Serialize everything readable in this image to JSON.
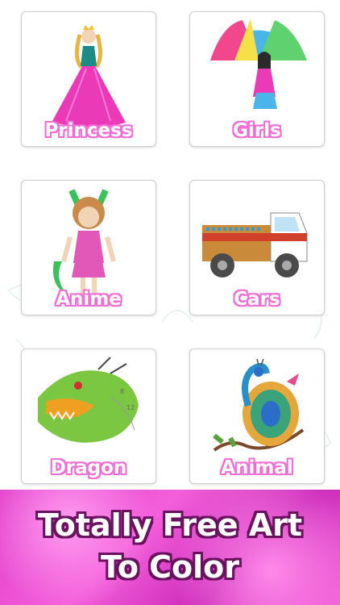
{
  "categories": [
    {
      "label": "Princess",
      "icon": "princess-illustration"
    },
    {
      "label": "Girls",
      "icon": "girl-umbrella-illustration"
    },
    {
      "label": "Anime",
      "icon": "anime-girl-illustration"
    },
    {
      "label": "Cars",
      "icon": "truck-illustration"
    },
    {
      "label": "Dragon",
      "icon": "dragon-illustration"
    },
    {
      "label": "Animal",
      "icon": "peacock-illustration"
    }
  ],
  "banner": {
    "line1": "Totally Free Art",
    "line2": "To Color"
  },
  "colors": {
    "label_outline": "#f06ed4",
    "banner_pink": "#e03cc8",
    "banner_text_outline": "#6a1260"
  }
}
